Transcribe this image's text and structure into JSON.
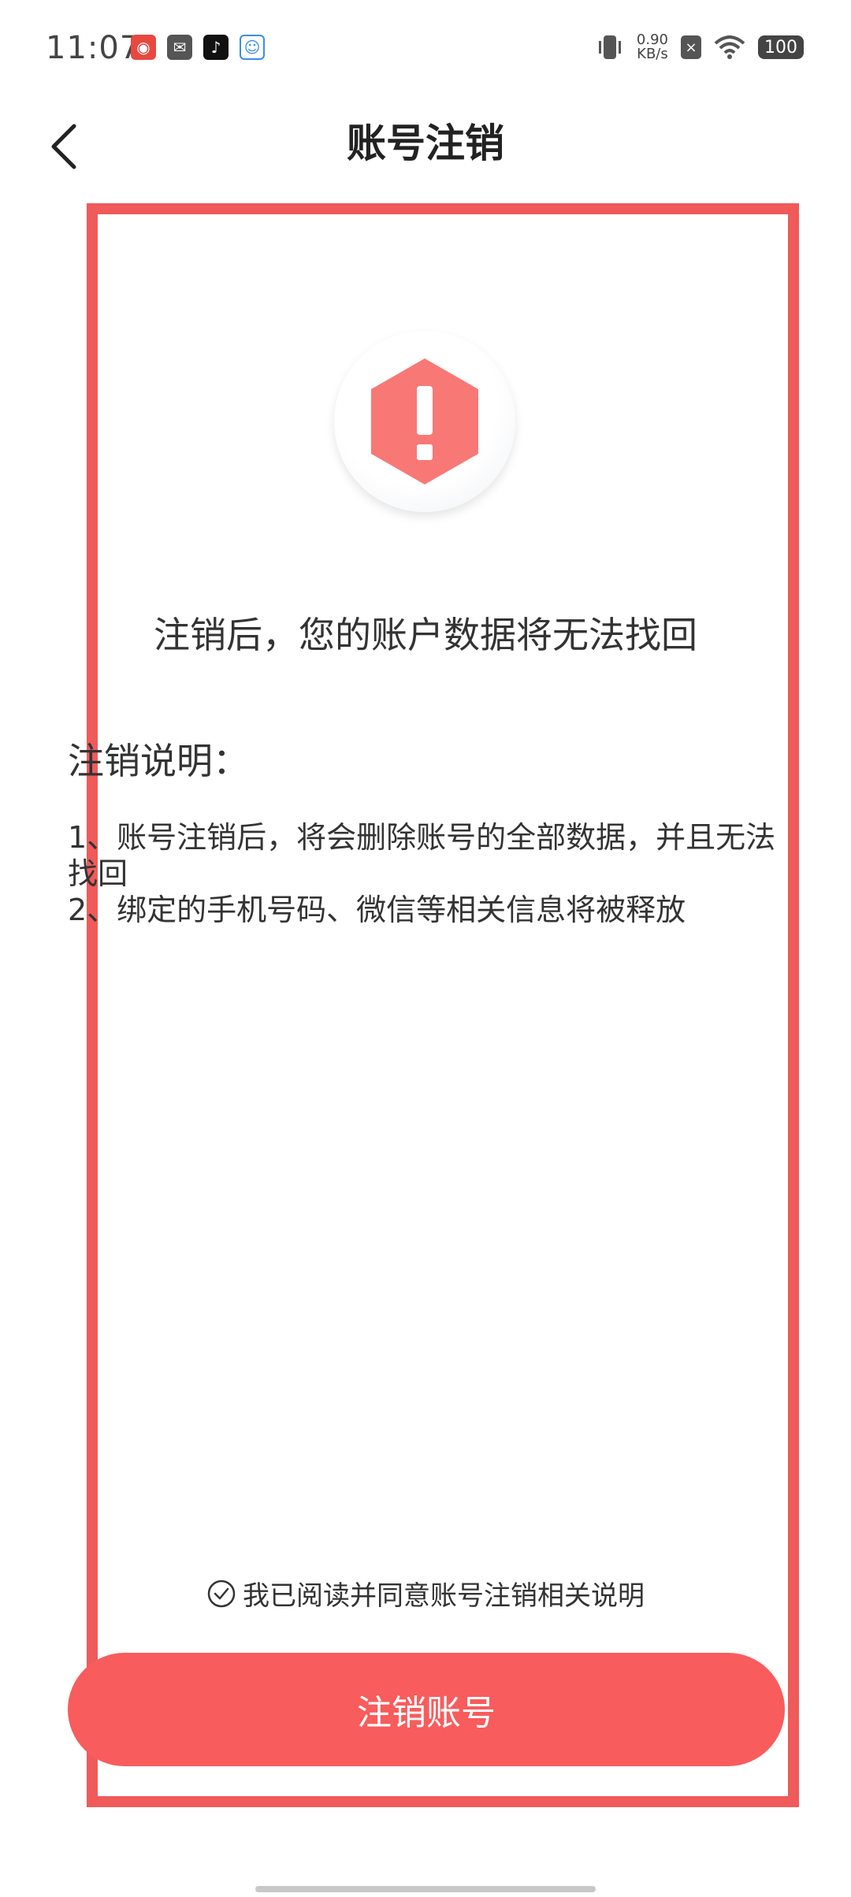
{
  "status_bar": {
    "time": "11:07",
    "net_speed_value": "0.90",
    "net_speed_unit": "KB/s",
    "battery": "100",
    "icons": [
      "app-icon-1",
      "mail-icon",
      "tiktok-icon",
      "qq-icon",
      "vibrate-icon",
      "close-box-icon",
      "wifi-icon",
      "battery-icon"
    ]
  },
  "header": {
    "title": "账号注销",
    "back_icon": "chevron-left-icon"
  },
  "warning": {
    "icon": "exclamation-hexagon-icon",
    "icon_color": "#f87876",
    "headline": "注销后，您的账户数据将无法找回"
  },
  "instructions": {
    "title": "注销说明：",
    "items": [
      "1、账号注销后，将会删除账号的全部数据，并且无法找回",
      "2、绑定的手机号码、微信等相关信息将被释放"
    ]
  },
  "agreement": {
    "text": "我已阅读并同意账号注销相关说明"
  },
  "primary_button": {
    "label": "注销账号",
    "color": "#f85c5c"
  }
}
